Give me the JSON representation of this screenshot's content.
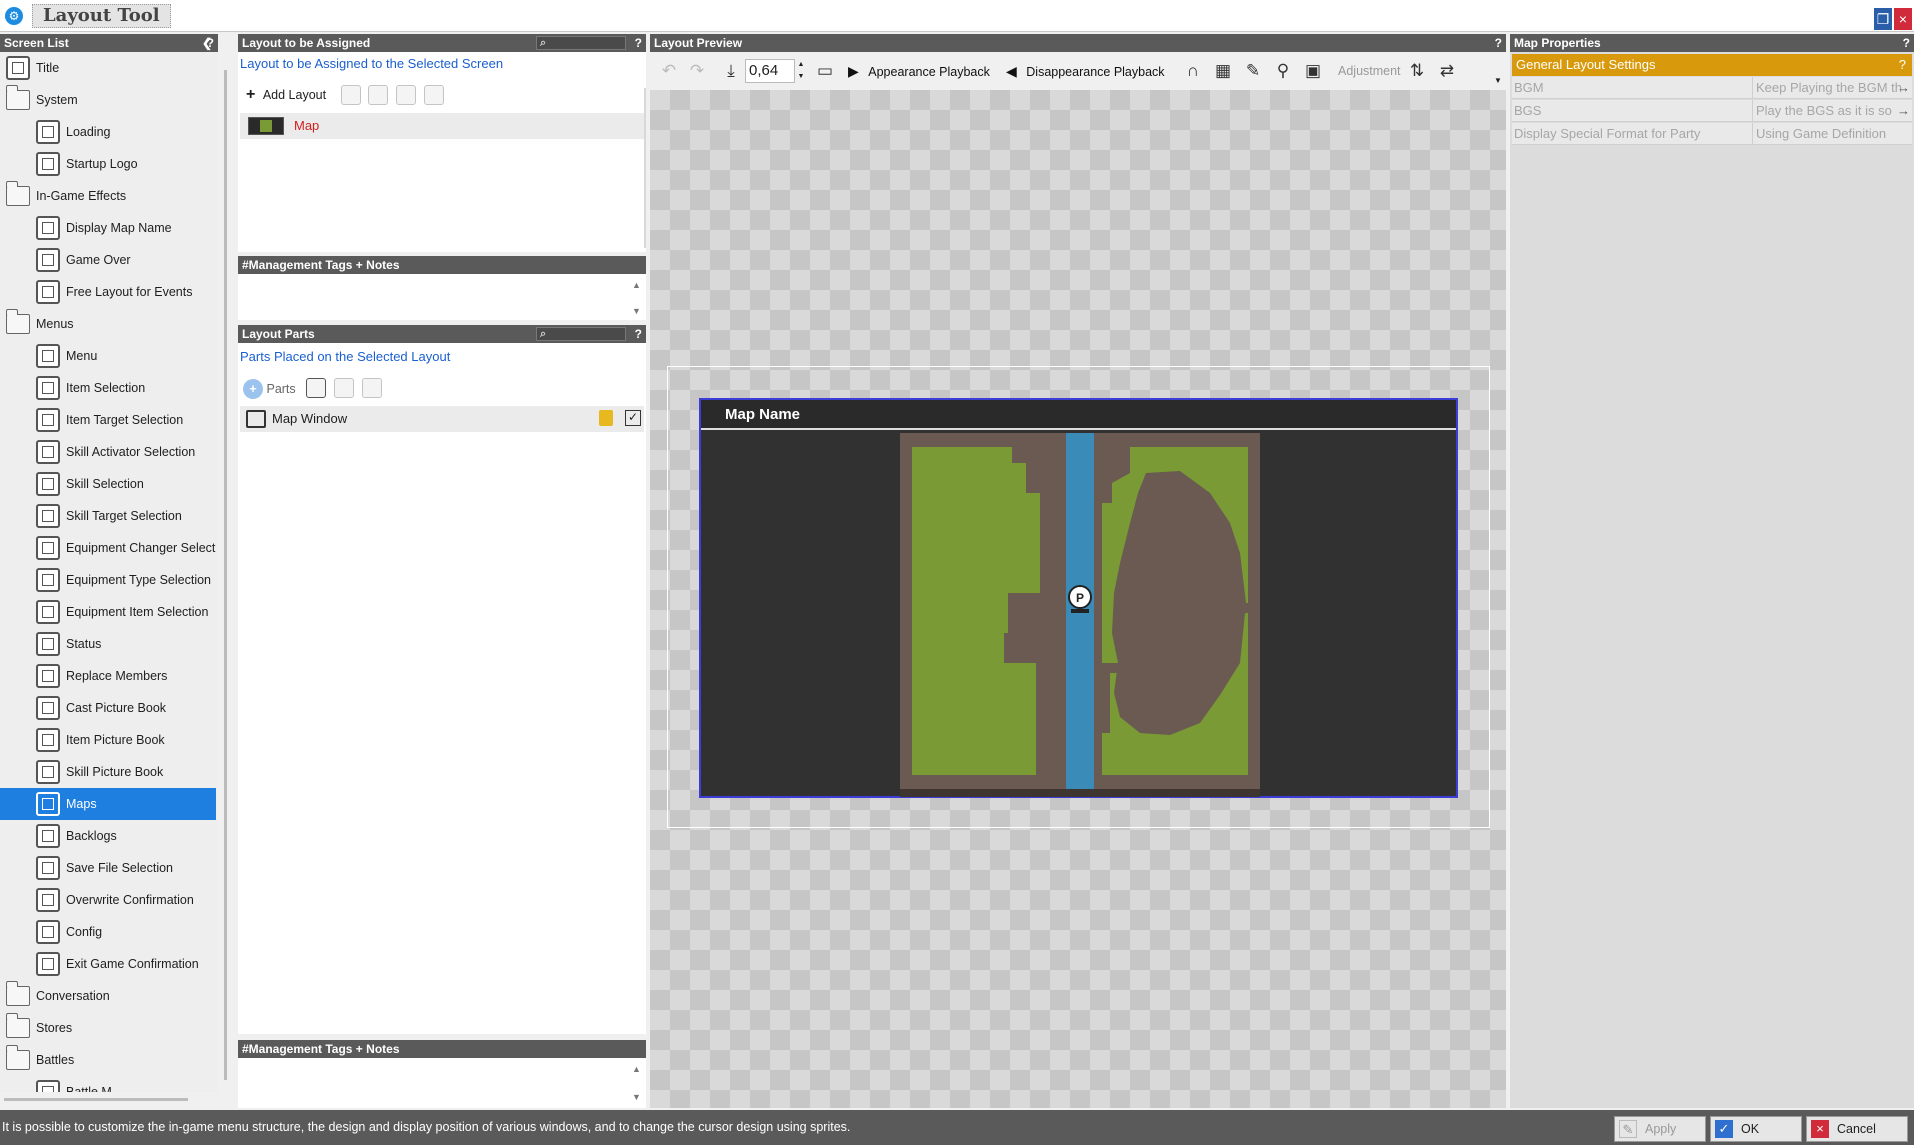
{
  "window": {
    "title": "Layout Tool"
  },
  "screen_list": {
    "header": "Screen List",
    "items": [
      {
        "label": "Title",
        "type": "screen",
        "indent": 0
      },
      {
        "label": "System",
        "type": "folder",
        "indent": 0
      },
      {
        "label": "Loading",
        "type": "screen",
        "indent": 1
      },
      {
        "label": "Startup Logo",
        "type": "screen",
        "indent": 1
      },
      {
        "label": "In-Game Effects",
        "type": "folder",
        "indent": 0
      },
      {
        "label": "Display Map Name",
        "type": "screen",
        "indent": 1
      },
      {
        "label": "Game Over",
        "type": "screen",
        "indent": 1
      },
      {
        "label": "Free Layout for Events",
        "type": "screen",
        "indent": 1
      },
      {
        "label": "Menus",
        "type": "folder",
        "indent": 0
      },
      {
        "label": "Menu",
        "type": "screen",
        "indent": 1
      },
      {
        "label": "Item Selection",
        "type": "screen",
        "indent": 1
      },
      {
        "label": "Item Target Selection",
        "type": "screen",
        "indent": 1
      },
      {
        "label": "Skill Activator Selection",
        "type": "screen",
        "indent": 1
      },
      {
        "label": "Skill Selection",
        "type": "screen",
        "indent": 1
      },
      {
        "label": "Skill Target Selection",
        "type": "screen",
        "indent": 1
      },
      {
        "label": "Equipment Changer Selecti",
        "type": "screen",
        "indent": 1
      },
      {
        "label": "Equipment Type Selection",
        "type": "screen",
        "indent": 1
      },
      {
        "label": "Equipment Item Selection",
        "type": "screen",
        "indent": 1
      },
      {
        "label": "Status",
        "type": "screen",
        "indent": 1
      },
      {
        "label": "Replace Members",
        "type": "screen",
        "indent": 1
      },
      {
        "label": "Cast Picture Book",
        "type": "screen",
        "indent": 1
      },
      {
        "label": "Item Picture Book",
        "type": "screen",
        "indent": 1
      },
      {
        "label": "Skill Picture Book",
        "type": "screen",
        "indent": 1
      },
      {
        "label": "Maps",
        "type": "screen",
        "indent": 1,
        "selected": true
      },
      {
        "label": "Backlogs",
        "type": "screen",
        "indent": 1
      },
      {
        "label": "Save File Selection",
        "type": "screen",
        "indent": 1
      },
      {
        "label": "Overwrite Confirmation",
        "type": "screen",
        "indent": 1
      },
      {
        "label": "Config",
        "type": "screen",
        "indent": 1
      },
      {
        "label": "Exit Game Confirmation",
        "type": "screen",
        "indent": 1
      },
      {
        "label": "Conversation",
        "type": "folder",
        "indent": 0
      },
      {
        "label": "Stores",
        "type": "folder",
        "indent": 0
      },
      {
        "label": "Battles",
        "type": "folder",
        "indent": 0
      },
      {
        "label": "Battle M...",
        "type": "screen",
        "indent": 1
      }
    ]
  },
  "layout_assign": {
    "header": "Layout to be Assigned",
    "subtitle": "Layout to be Assigned to the Selected Screen",
    "add_label": "Add Layout",
    "items": [
      {
        "label": "Map"
      }
    ]
  },
  "tags_top": {
    "header": "#Management Tags + Notes"
  },
  "layout_parts": {
    "header": "Layout Parts",
    "subtitle": "Parts Placed on the Selected Layout",
    "parts_label": "Parts",
    "items": [
      {
        "label": "Map Window"
      }
    ]
  },
  "tags_bottom": {
    "header": "#Management Tags + Notes"
  },
  "preview": {
    "header": "Layout Preview",
    "zoom": "0,64",
    "appearance_label": "Appearance Playback",
    "disappearance_label": "Disappearance Playback",
    "adjustment_label": "Adjustment",
    "map_window_title": "Map Name",
    "marker_letter": "P"
  },
  "properties": {
    "header": "Map Properties",
    "section": "General Layout Settings",
    "rows": [
      {
        "key": "BGM",
        "value": "Keep Playing the BGM th"
      },
      {
        "key": "BGS",
        "value": "Play the BGS as it is so"
      },
      {
        "key": "Display Special Format for Party",
        "value": "Using Game Definition"
      }
    ]
  },
  "status": {
    "message": "It is possible to customize the in-game menu structure, the design and display position of various windows, and to change the cursor design using sprites.",
    "apply_label": "Apply",
    "ok_label": "OK",
    "cancel_label": "Cancel"
  },
  "colors": {
    "accent": "#1e7fe0",
    "section": "#d89a0c",
    "grass": "#7a9a35",
    "dirt": "#6a5a52",
    "water": "#3a8bb8"
  }
}
